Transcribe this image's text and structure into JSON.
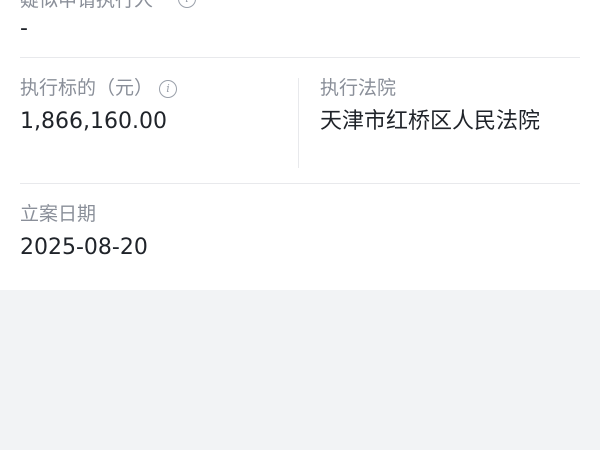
{
  "applicant": {
    "label": "疑似申请执行人",
    "value": "-"
  },
  "exec_amount": {
    "label": "执行标的（元）",
    "value": "1,866,160.00",
    "info_icon": "info-icon"
  },
  "exec_court": {
    "label": "执行法院",
    "value": "天津市红桥区人民法院"
  },
  "filing_date": {
    "label": "立案日期",
    "value": "2025-08-20"
  }
}
